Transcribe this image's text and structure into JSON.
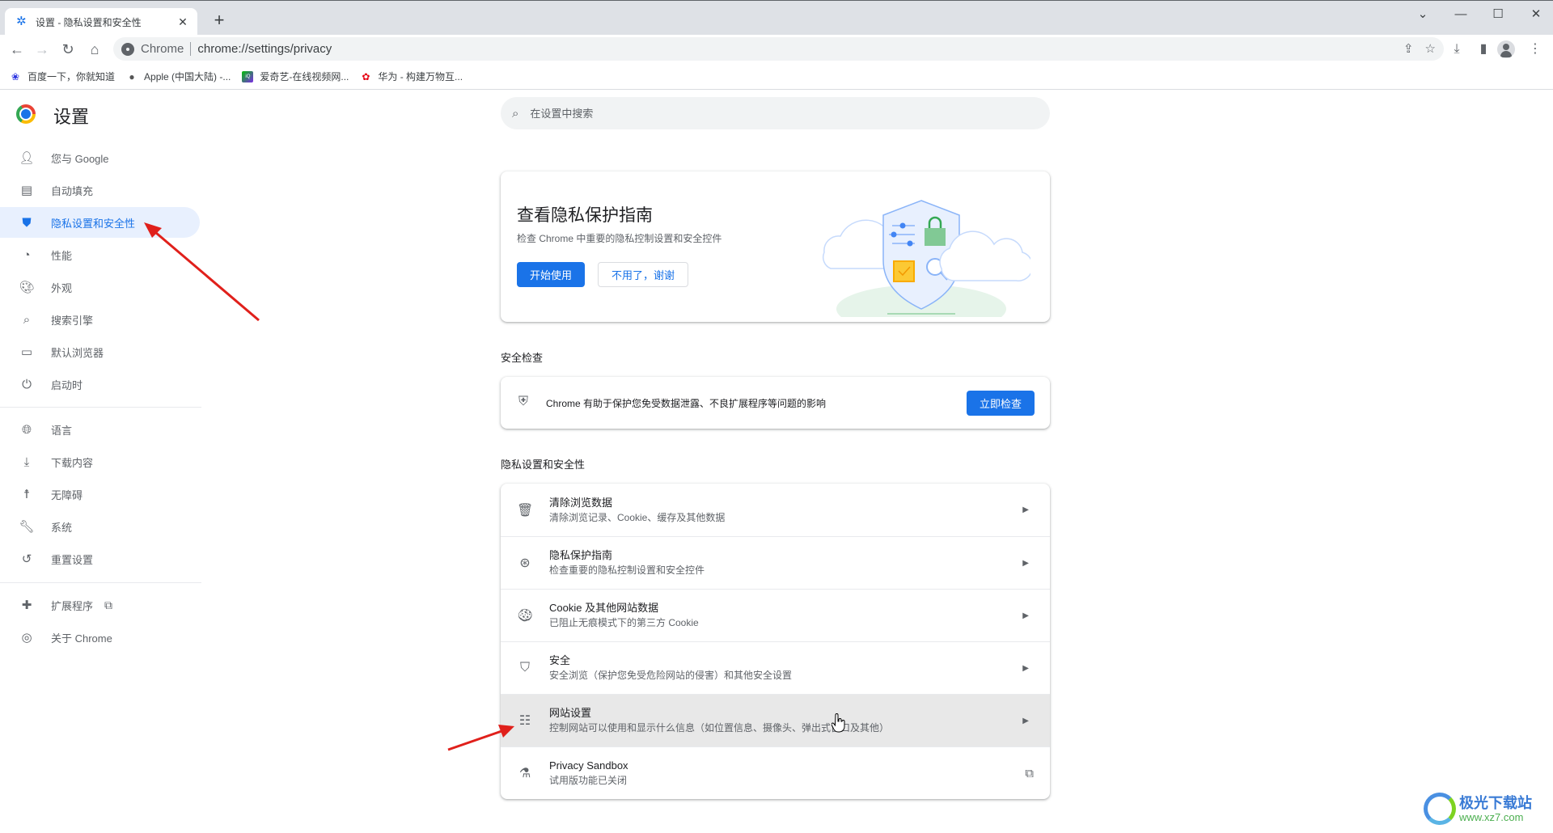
{
  "browser": {
    "tab": {
      "title": "设置 - 隐私设置和安全性",
      "icon": "gear-icon"
    },
    "new_tab_label": "+",
    "window_controls": [
      "tab-search",
      "minimize",
      "maximize",
      "close"
    ],
    "omnibox": {
      "site_label": "Chrome",
      "url": "chrome://settings/privacy"
    },
    "bookmarks": [
      {
        "label": "百度一下，你就知道",
        "icon": "baidu-paw-icon"
      },
      {
        "label": "Apple (中国大陆) -...",
        "icon": "apple-icon"
      },
      {
        "label": "爱奇艺-在线视频网...",
        "icon": "iqiyi-icon"
      },
      {
        "label": "华为 - 构建万物互...",
        "icon": "huawei-icon"
      }
    ]
  },
  "sidebar": {
    "title": "设置",
    "items": [
      {
        "label": "您与 Google",
        "icon": "person-icon"
      },
      {
        "label": "自动填充",
        "icon": "clipboard-icon"
      },
      {
        "label": "隐私设置和安全性",
        "icon": "shield-icon",
        "active": true
      },
      {
        "label": "性能",
        "icon": "speedometer-icon"
      },
      {
        "label": "外观",
        "icon": "palette-icon"
      },
      {
        "label": "搜索引擎",
        "icon": "search-icon"
      },
      {
        "label": "默认浏览器",
        "icon": "browser-window-icon"
      },
      {
        "label": "启动时",
        "icon": "power-icon"
      },
      {
        "label": "语言",
        "icon": "globe-icon"
      },
      {
        "label": "下载内容",
        "icon": "download-icon"
      },
      {
        "label": "无障碍",
        "icon": "accessibility-icon"
      },
      {
        "label": "系统",
        "icon": "wrench-icon"
      },
      {
        "label": "重置设置",
        "icon": "history-icon"
      },
      {
        "label": "扩展程序",
        "icon": "puzzle-icon",
        "external": true
      },
      {
        "label": "关于 Chrome",
        "icon": "chrome-icon"
      }
    ]
  },
  "main": {
    "search": {
      "placeholder": "在设置中搜索",
      "value": ""
    },
    "privacy_guide_card": {
      "title": "查看隐私保护指南",
      "subtitle": "检查 Chrome 中重要的隐私控制设置和安全控件",
      "primary_button": "开始使用",
      "secondary_button": "不用了，谢谢"
    },
    "safety_check": {
      "section_title": "安全检查",
      "text": "Chrome 有助于保护您免受数据泄露、不良扩展程序等问题的影响",
      "button": "立即检查"
    },
    "privacy_section": {
      "section_title": "隐私设置和安全性",
      "rows": [
        {
          "title": "清除浏览数据",
          "subtitle": "清除浏览记录、Cookie、缓存及其他数据",
          "icon": "trash-icon",
          "action": "arrow"
        },
        {
          "title": "隐私保护指南",
          "subtitle": "检查重要的隐私控制设置和安全控件",
          "icon": "compass-icon",
          "action": "arrow"
        },
        {
          "title": "Cookie 及其他网站数据",
          "subtitle": "已阻止无痕模式下的第三方 Cookie",
          "icon": "cookie-icon",
          "action": "arrow"
        },
        {
          "title": "安全",
          "subtitle": "安全浏览（保护您免受危险网站的侵害）和其他安全设置",
          "icon": "security-shield-icon",
          "action": "arrow"
        },
        {
          "title": "网站设置",
          "subtitle": "控制网站可以使用和显示什么信息（如位置信息、摄像头、弹出式窗口及其他）",
          "icon": "tune-icon",
          "action": "arrow",
          "hovered": true
        },
        {
          "title": "Privacy Sandbox",
          "subtitle": "试用版功能已关闭",
          "icon": "flask-icon",
          "action": "external"
        }
      ]
    }
  },
  "colors": {
    "accent": "#1a73e8",
    "active_bg": "#e8f0fe",
    "hover_row": "#e8e8e8",
    "annotation_arrow": "#e0201b"
  },
  "watermark": {
    "name": "极光下载站",
    "url": "www.xz7.com"
  }
}
